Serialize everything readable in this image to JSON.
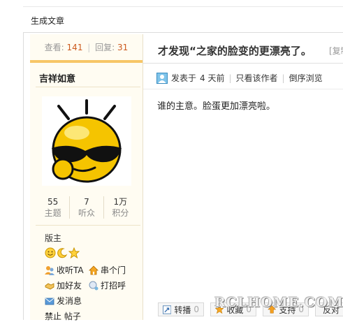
{
  "top": {
    "generate_label": "生成文章"
  },
  "sidebar": {
    "views_label": "查看:",
    "views": "141",
    "replies_label": "回复:",
    "replies": "31",
    "username": "吉祥如意",
    "counts": [
      {
        "value": "55",
        "label": "主题"
      },
      {
        "value": "7",
        "label": "听众"
      },
      {
        "value": "1万",
        "label": "积分"
      }
    ],
    "group": "版主",
    "actions": {
      "follow": "收听TA",
      "visit": "串个门",
      "add_friend": "加好友",
      "greet": "打招呼",
      "message": "发消息",
      "ban": "禁止 帖子"
    }
  },
  "post": {
    "title": "才发现“之家的脸变的更漂亮了。",
    "copy_link": "[复制",
    "posted_label": "发表于",
    "posted_time": "4 天前",
    "only_author": "只看该作者",
    "reverse": "倒序浏览",
    "content": "谁的主意。脸蛋更加漂亮啦。"
  },
  "toolbar": {
    "relay": "转播",
    "relay_count": "0",
    "fav": "收藏",
    "fav_count": "0",
    "support": "支持",
    "support_count": "0",
    "oppose": "反对"
  },
  "watermark": "RCLHOME.COM"
}
